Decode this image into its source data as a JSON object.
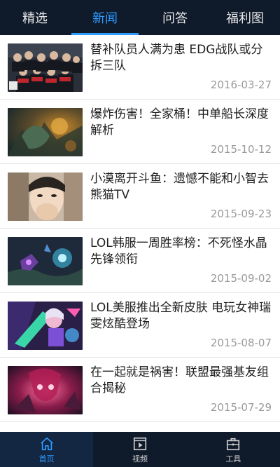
{
  "top_tabs": [
    {
      "label": "精选"
    },
    {
      "label": "新闻"
    },
    {
      "label": "问答"
    },
    {
      "label": "福利图"
    }
  ],
  "active_tab": "新闻",
  "news": [
    {
      "title": "替补队员人满为患 EDG战队或分拆三队",
      "date": "2016-03-27"
    },
    {
      "title": "爆炸伤害！全家桶！中单船长深度解析",
      "date": "2015-10-12"
    },
    {
      "title": "小漠离开斗鱼：遗憾不能和小智去熊猫TV",
      "date": "2015-09-23"
    },
    {
      "title": "LOL韩服一周胜率榜：不死怪水晶先锋领衔",
      "date": "2015-09-02"
    },
    {
      "title": "LOL美服推出全新皮肤 电玩女神瑞雯炫酷登场",
      "date": "2015-08-07"
    },
    {
      "title": "在一起就是祸害！联盟最强基友组合揭秘",
      "date": "2015-07-29"
    }
  ],
  "bottom_nav": [
    {
      "label": "首页",
      "icon": "home-icon"
    },
    {
      "label": "视频",
      "icon": "video-icon"
    },
    {
      "label": "工具",
      "icon": "toolbox-icon"
    }
  ],
  "colors": {
    "bar_bg": "#0f1a2b",
    "accent": "#2f9bff",
    "date_text": "#9a9a9a"
  }
}
